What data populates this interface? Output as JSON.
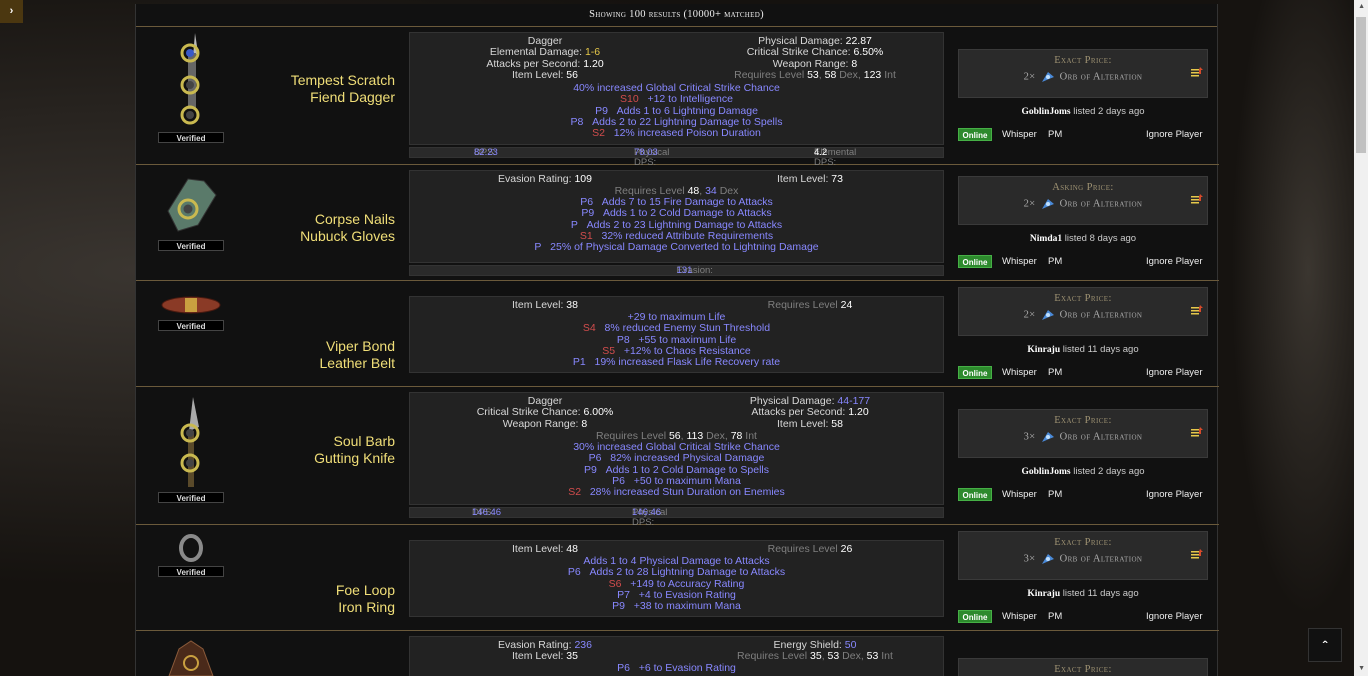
{
  "header": {
    "results": "Showing 100 results (10000+ matched)"
  },
  "nav": {
    "toggle_glyph": "›",
    "scroll_top_glyph": "ˆ"
  },
  "verified_label": "Verified",
  "currency": "Orb of Alteration",
  "actions": {
    "online": "Online",
    "whisper": "Whisper",
    "pm": "PM",
    "ignore": "Ignore Player"
  },
  "items": [
    {
      "name1": "Tempest Scratch",
      "name2": "Fiend Dagger",
      "base": "Dagger",
      "elem_label": "Elemental Damage:",
      "elem_val": "1-6",
      "aps_label": "Attacks per Second:",
      "aps_val": "1.20",
      "ilvl_label": "Item Level:",
      "ilvl_val": "56",
      "phys_label": "Physical Damage:",
      "phys_val": "22.87",
      "crit_label": "Critical Strike Chance:",
      "crit_val": "6.50%",
      "range_label": "Weapon Range:",
      "range_val": "8",
      "req": "Requires Level",
      "req_lvl": "53",
      "req_a": "58",
      "req_a_lbl": "Dex,",
      "req_b": "123",
      "req_b_lbl": "Int",
      "implicit": "40% increased Global Critical Strike Chance",
      "mods": [
        [
          "S10",
          "+12 to Intelligence"
        ],
        [
          "P9",
          "Adds 1 to 6 Lightning Damage"
        ],
        [
          "P8",
          "Adds 2 to 22 Lightning Damage to Spells"
        ],
        [
          "S2",
          "12% increased Poison Duration"
        ]
      ],
      "dps_label": "DPS:",
      "dps": "82.23",
      "pdps_label": "Physical DPS:",
      "pdps": "78.03",
      "edps_label": "Elemental DPS:",
      "edps": "4.2",
      "price_label": "Exact Price:",
      "qty": "2",
      "seller": "GoblinJoms",
      "listed": "listed 2 days ago"
    },
    {
      "name1": "Corpse Nails",
      "name2": "Nubuck Gloves",
      "ev_label": "Evasion Rating:",
      "ev_val": "109",
      "ilvl_label": "Item Level:",
      "ilvl_val": "73",
      "req": "Requires Level",
      "req_lvl": "48",
      "req_a": "34",
      "req_a_lbl": "Dex",
      "mods": [
        [
          "P6",
          "Adds 7 to 15 Fire Damage to Attacks"
        ],
        [
          "P9",
          "Adds 1 to 2 Cold Damage to Attacks"
        ],
        [
          "P",
          "Adds 2 to 23 Lightning Damage to Attacks"
        ],
        [
          "S1",
          "32% reduced Attribute Requirements"
        ],
        [
          "P",
          "25% of Physical Damage Converted to Lightning Damage"
        ]
      ],
      "foot_label": "Evasion:",
      "foot_val": "131",
      "price_label": "Asking Price:",
      "qty": "2",
      "seller": "Nimda1",
      "listed": "listed 8 days ago"
    },
    {
      "name1": "Viper Bond",
      "name2": "Leather Belt",
      "ilvl_label": "Item Level:",
      "ilvl_val": "38",
      "req": "Requires Level",
      "req_lvl": "24",
      "implicit": "+29 to maximum Life",
      "mods": [
        [
          "S4",
          "8% reduced Enemy Stun Threshold"
        ],
        [
          "P8",
          "+55 to maximum Life"
        ],
        [
          "S5",
          "+12% to Chaos Resistance"
        ],
        [
          "P1",
          "19% increased Flask Life Recovery rate"
        ]
      ],
      "price_label": "Exact Price:",
      "qty": "2",
      "seller": "Kinraju",
      "listed": "listed 11 days ago"
    },
    {
      "name1": "Soul Barb",
      "name2": "Gutting Knife",
      "base": "Dagger",
      "crit_label": "Critical Strike Chance:",
      "crit_val": "6.00%",
      "range_label": "Weapon Range:",
      "range_val": "8",
      "phys_label": "Physical Damage:",
      "phys_val": "44-177",
      "aps_label": "Attacks per Second:",
      "aps_val": "1.20",
      "ilvl_label": "Item Level:",
      "ilvl_val": "58",
      "req": "Requires Level",
      "req_lvl": "56",
      "req_a": "113",
      "req_a_lbl": "Dex,",
      "req_b": "78",
      "req_b_lbl": "Int",
      "implicit": "30% increased Global Critical Strike Chance",
      "mods": [
        [
          "P6",
          "82% increased Physical Damage"
        ],
        [
          "P9",
          "Adds 1 to 2 Cold Damage to Spells"
        ],
        [
          "P6",
          "+50 to maximum Mana"
        ],
        [
          "S2",
          "28% increased Stun Duration on Enemies"
        ]
      ],
      "dps_label": "DPS:",
      "dps": "146.46",
      "pdps_label": "Physical DPS:",
      "pdps": "146.46",
      "price_label": "Exact Price:",
      "qty": "3",
      "seller": "GoblinJoms",
      "listed": "listed 2 days ago"
    },
    {
      "name1": "Foe Loop",
      "name2": "Iron Ring",
      "ilvl_label": "Item Level:",
      "ilvl_val": "48",
      "req": "Requires Level",
      "req_lvl": "26",
      "implicit": "Adds 1 to 4 Physical Damage to Attacks",
      "mods": [
        [
          "P6",
          "Adds 2 to 28 Lightning Damage to Attacks"
        ],
        [
          "S6",
          "+149 to Accuracy Rating"
        ],
        [
          "P7",
          "+4 to Evasion Rating"
        ],
        [
          "P9",
          "+38 to maximum Mana"
        ]
      ],
      "price_label": "Exact Price:",
      "qty": "3",
      "seller": "Kinraju",
      "listed": "listed 11 days ago"
    },
    {
      "ev_label": "Evasion Rating:",
      "ev_val": "236",
      "ilvl_label": "Item Level:",
      "ilvl_val": "35",
      "es_label": "Energy Shield:",
      "es_val": "50",
      "req": "Requires Level",
      "req_lvl": "35",
      "req_a": "53",
      "req_a_lbl": "Dex,",
      "req_b": "53",
      "req_b_lbl": "Int",
      "mods": [
        [
          "P6",
          "+6 to Evasion Rating"
        ]
      ],
      "price_label": "Exact Price:"
    }
  ]
}
